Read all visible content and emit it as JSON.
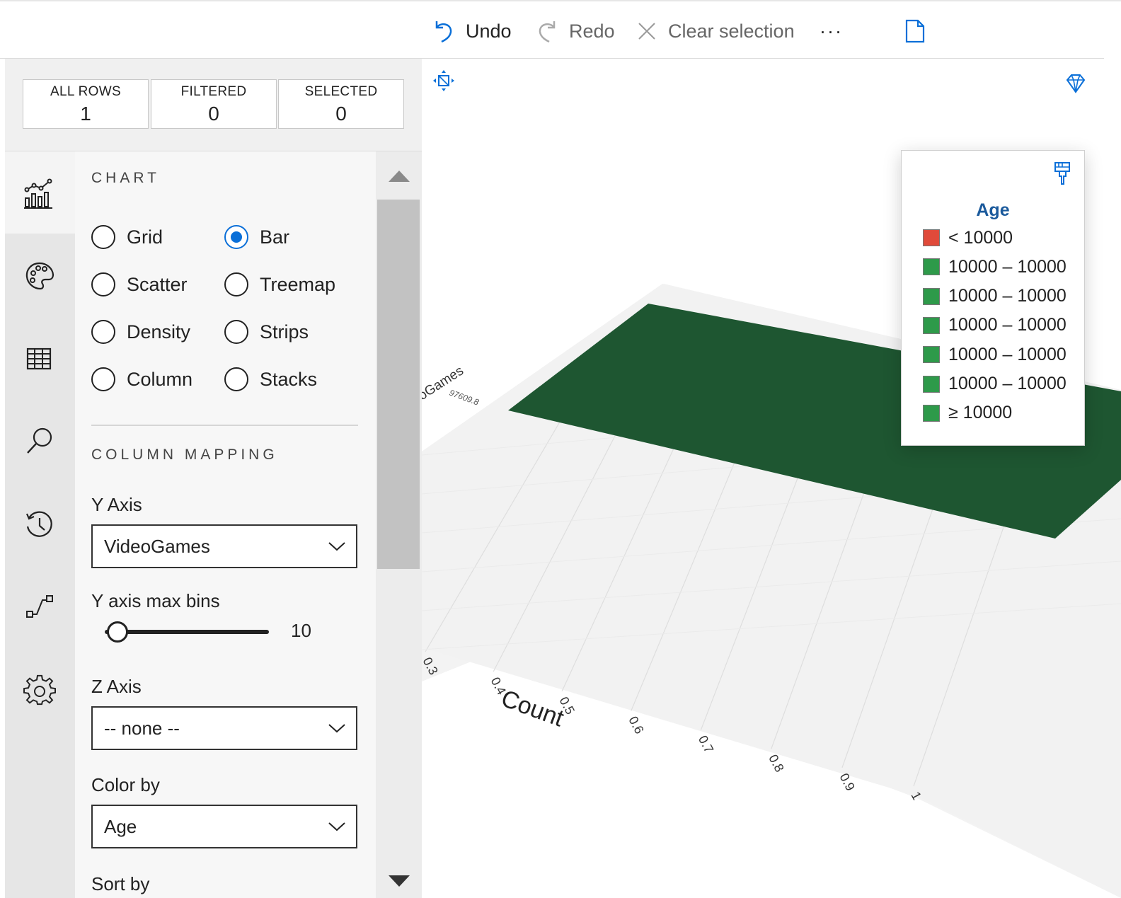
{
  "toolbar": {
    "undo_label": "Undo",
    "redo_label": "Redo",
    "clear_label": "Clear selection",
    "more_label": "···"
  },
  "counts": [
    {
      "label": "ALL ROWS",
      "value": "1"
    },
    {
      "label": "FILTERED",
      "value": "0"
    },
    {
      "label": "SELECTED",
      "value": "0"
    }
  ],
  "sidebar": {
    "icons": [
      "chart-icon",
      "palette-icon",
      "table-icon",
      "search-icon",
      "history-icon",
      "transition-icon",
      "gear-icon"
    ],
    "active": "chart-icon"
  },
  "panel": {
    "chart_section": "CHART",
    "chart_types": [
      {
        "label": "Grid",
        "selected": false
      },
      {
        "label": "Bar",
        "selected": true
      },
      {
        "label": "Scatter",
        "selected": false
      },
      {
        "label": "Treemap",
        "selected": false
      },
      {
        "label": "Density",
        "selected": false
      },
      {
        "label": "Strips",
        "selected": false
      },
      {
        "label": "Column",
        "selected": false
      },
      {
        "label": "Stacks",
        "selected": false
      }
    ],
    "mapping_section": "COLUMN MAPPING",
    "y_axis_label": "Y Axis",
    "y_axis_value": "VideoGames",
    "y_bins_label": "Y axis max bins",
    "y_bins_value": "10",
    "z_axis_label": "Z Axis",
    "z_axis_value": "-- none --",
    "color_by_label": "Color by",
    "color_by_value": "Age",
    "sort_by_label": "Sort by"
  },
  "chart_data": {
    "type": "bar",
    "xlabel": "Count",
    "ylabel": "VideoGames",
    "categories": [
      "97609.8"
    ],
    "values": [
      1
    ],
    "x_ticks": [
      "0.3",
      "0.4",
      "0.5",
      "0.6",
      "0.7",
      "0.8",
      "0.9",
      "1"
    ],
    "y_tick": "97609.8",
    "ylabel_visible": "oGames",
    "bar_color": "#1e5631"
  },
  "legend": {
    "title": "Age",
    "items": [
      {
        "label": "< 10000",
        "color": "#e04a3a"
      },
      {
        "label": "10000 – 10000",
        "color": "#2e9a4a"
      },
      {
        "label": "10000 – 10000",
        "color": "#2e9a4a"
      },
      {
        "label": "10000 – 10000",
        "color": "#2e9a4a"
      },
      {
        "label": "10000 – 10000",
        "color": "#2e9a4a"
      },
      {
        "label": "10000 – 10000",
        "color": "#2e9a4a"
      },
      {
        "label": "≥ 10000",
        "color": "#2e9a4a"
      }
    ]
  },
  "colors": {
    "accent": "#0a6fd8",
    "legend_title": "#1b5a9c"
  }
}
